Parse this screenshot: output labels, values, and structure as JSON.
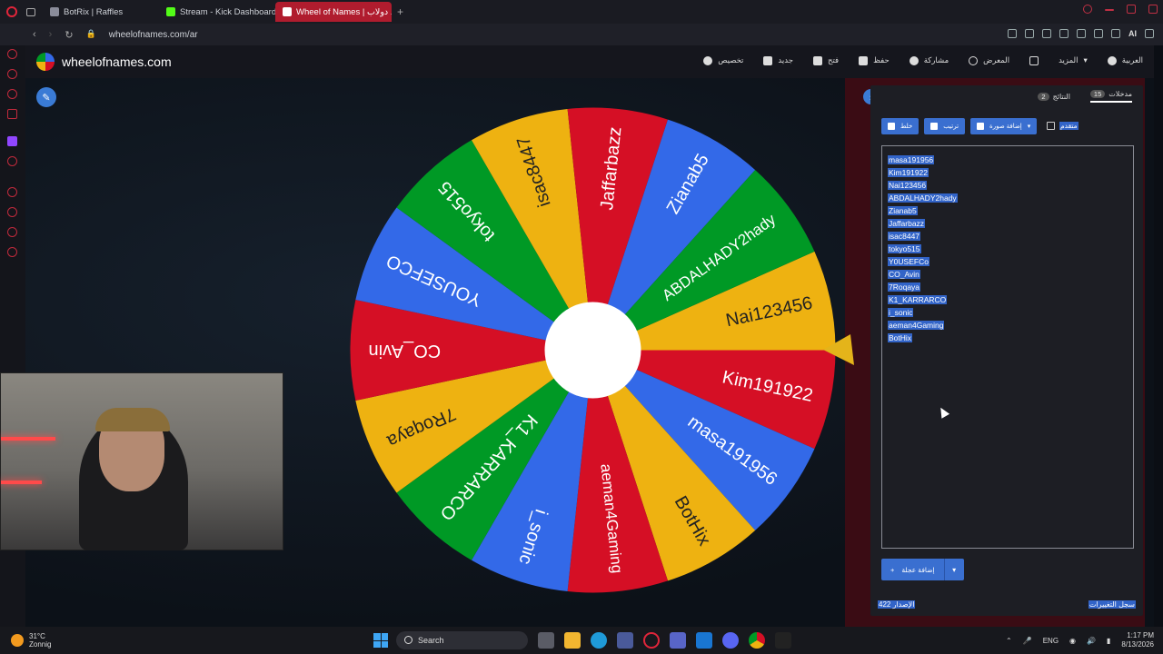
{
  "browser": {
    "tabs": [
      {
        "label": "BotRix | Raffles",
        "color": "#8a8c9a",
        "active": false
      },
      {
        "label": "Stream - Kick Dashboard",
        "color": "#53fc18",
        "active": false
      },
      {
        "label": "Wheel of Names | دولاب ...",
        "color": "#e0253a",
        "active": true
      }
    ],
    "new_tab": "+",
    "url": "wheelofnames.com/ar",
    "ai_label": "AI"
  },
  "site": {
    "brand": "wheelofnames.com",
    "menu": [
      {
        "name": "language",
        "label": "العربية"
      },
      {
        "name": "more",
        "label": "المزيد"
      },
      {
        "name": "fullscreen",
        "label": ""
      },
      {
        "name": "gallery",
        "label": "المعرض"
      },
      {
        "name": "share",
        "label": "مشاركة"
      },
      {
        "name": "save",
        "label": "حفظ"
      },
      {
        "name": "open",
        "label": "فتح"
      },
      {
        "name": "new",
        "label": "جديد"
      },
      {
        "name": "customize",
        "label": "تخصيص"
      }
    ]
  },
  "panel": {
    "tabs": [
      {
        "label": "النتائج",
        "count": "2"
      },
      {
        "label": "مدخلات",
        "count": "15"
      }
    ],
    "shuffle_label": "خلط",
    "sort_label": "ترتيب",
    "add_image_label": "إضافة صورة",
    "advanced_label": "متقدم",
    "entries": [
      "masa191956",
      "Kim191922",
      "Nai123456",
      "ABDALHADY2hady",
      "Zianab5",
      "Jaffarbazz",
      "isac8447",
      "tokyo515",
      "Y0USEFCo",
      "CO_Avin",
      "7Roqaya",
      "K1_KARRARCO",
      "i_sonic",
      "aeman4Gaming",
      "BotHix"
    ],
    "add_images_button": "إضافة عجلة",
    "version": "الإصدار 422",
    "changelog": "سجل التغييرات"
  },
  "wheel": {
    "colors": {
      "blue": "#3369e8",
      "red": "#d50f25",
      "yellow": "#eeb211",
      "green": "#009925"
    },
    "segments": [
      {
        "label": "Nai123456",
        "color": "#eeb211"
      },
      {
        "label": "Kim191922",
        "color": "#d50f25"
      },
      {
        "label": "masa191956",
        "color": "#3369e8"
      },
      {
        "label": "BotHix",
        "color": "#eeb211"
      },
      {
        "label": "aeman4Gaming",
        "color": "#d50f25"
      },
      {
        "label": "i_sonic",
        "color": "#3369e8"
      },
      {
        "label": "K1_KARRARCO",
        "color": "#009925"
      },
      {
        "label": "7Roqaya",
        "color": "#eeb211"
      },
      {
        "label": "CO_Avin",
        "color": "#d50f25"
      },
      {
        "label": "YOUSEFCO",
        "color": "#3369e8"
      },
      {
        "label": "tokyo515",
        "color": "#009925"
      },
      {
        "label": "isac8447",
        "color": "#eeb211"
      },
      {
        "label": "Jaffarbazz",
        "color": "#d50f25"
      },
      {
        "label": "Zianab5",
        "color": "#3369e8"
      },
      {
        "label": "ABDALHADY2hady",
        "color": "#009925"
      }
    ]
  },
  "taskbar": {
    "temp": "31°C",
    "weather": "Zonnig",
    "search": "Search",
    "lang": "ENG",
    "time": "1:17 PM",
    "date": "8/13/2026"
  }
}
